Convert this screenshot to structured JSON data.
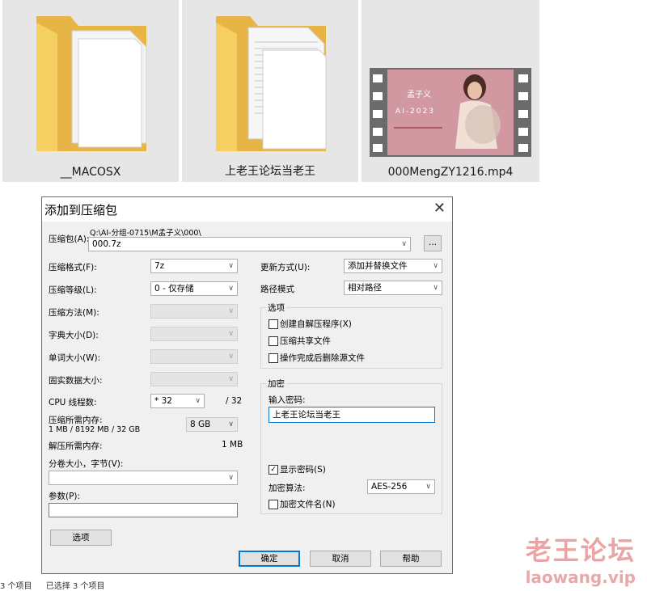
{
  "explorer": {
    "items": [
      {
        "label": "__MACOSX"
      },
      {
        "label": "上老王论坛当老王"
      },
      {
        "label": "000MengZY1216.mp4"
      }
    ],
    "thumbnail_overlay": {
      "name": "孟子义",
      "year": "AI-2023"
    },
    "status": {
      "count": "3 个项目",
      "selected": "已选择 3 个项目"
    }
  },
  "dialog": {
    "title": "添加到压缩包",
    "archive": {
      "label": "压缩包(A):",
      "path": "Q:\\AI-分组-0715\\M孟子义\\000\\",
      "value": "000.7z",
      "browse": "..."
    },
    "left": {
      "format_label": "压缩格式(F):",
      "format_value": "7z",
      "level_label": "压缩等级(L):",
      "level_value": "0 - 仅存储",
      "method_label": "压缩方法(M):",
      "dict_label": "字典大小(D):",
      "word_label": "单词大小(W):",
      "solid_label": "固实数据大小:",
      "threads_label": "CPU 线程数:",
      "threads_value": "* 32",
      "threads_total": "/ 32",
      "mem_comp_label": "压缩所需内存:",
      "mem_comp_detail": "1 MB / 8192 MB / 32 GB",
      "mem_comp_value": "8 GB",
      "mem_decomp_label": "解压所需内存:",
      "mem_decomp_value": "1 MB",
      "split_label": "分卷大小，字节(V):",
      "split_value": "",
      "params_label": "参数(P):",
      "params_value": "",
      "options_button": "选项"
    },
    "right": {
      "update_label": "更新方式(U):",
      "update_value": "添加并替换文件",
      "path_label": "路径模式",
      "path_value": "相对路径",
      "options_group": "选项",
      "opt_sfx": "创建自解压程序(X)",
      "opt_shared": "压缩共享文件",
      "opt_delete": "操作完成后删除源文件",
      "encrypt_group": "加密",
      "password_label": "输入密码:",
      "password_value": "上老王论坛当老王",
      "show_password": "显示密码(S)",
      "show_password_checked": "✓",
      "enc_method_label": "加密算法:",
      "enc_method_value": "AES-256",
      "encrypt_names": "加密文件名(N)"
    },
    "buttons": {
      "ok": "确定",
      "cancel": "取消",
      "help": "帮助"
    }
  },
  "watermark": {
    "line1": "老王论坛",
    "line2": "laowang.vip"
  },
  "colors": {
    "folder_front": "#f8d775",
    "folder_back": "#e6b545",
    "accent": "#0078d7",
    "dialog_bg": "#f0f0f0",
    "tile_bg": "#e6e6e6"
  }
}
